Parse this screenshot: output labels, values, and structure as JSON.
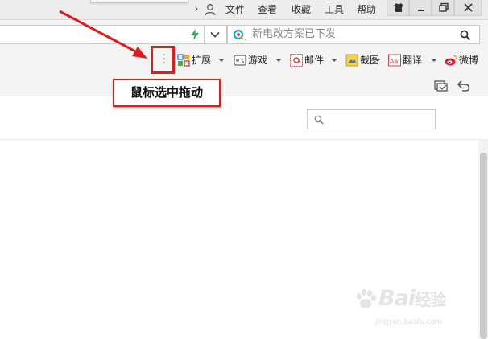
{
  "menubar": {
    "items": [
      {
        "label": "文件"
      },
      {
        "label": "查看"
      },
      {
        "label": "收藏"
      },
      {
        "label": "工具"
      },
      {
        "label": "帮助"
      }
    ],
    "window_buttons": [
      "skin-icon",
      "minimize-icon",
      "restore-icon",
      "close-icon"
    ]
  },
  "address": {
    "url": "",
    "dropdown_icon": "chevron-down-icon",
    "accel_icon": "lightning-icon"
  },
  "search": {
    "placeholder": "新电改方案已下发",
    "engine_icon": "search-engine-q-icon",
    "go_icon": "magnifier-icon"
  },
  "extensions": {
    "items": [
      {
        "label": "扩展",
        "icon": "extension-grid-icon",
        "has_menu": true
      },
      {
        "label": "游戏",
        "icon": "gamepad-icon",
        "has_menu": true
      },
      {
        "label": "邮件",
        "icon": "mail-at-icon",
        "has_menu": true
      },
      {
        "label": "截图",
        "icon": "screenshot-icon",
        "has_menu": true
      },
      {
        "label": "翻译",
        "icon": "translate-aa-icon",
        "has_menu": true
      },
      {
        "label": "微博",
        "icon": "weibo-icon",
        "has_menu": false
      }
    ]
  },
  "annotation": {
    "label": "鼠标选中拖动",
    "color": "#e11c1c"
  },
  "watermark": {
    "brand": "Bai",
    "brand_suffix": "经验",
    "url": "jingyan.baidu.com"
  }
}
